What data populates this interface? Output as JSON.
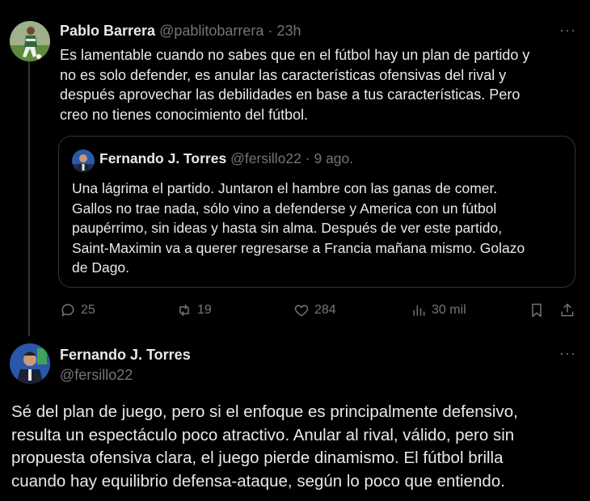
{
  "tweet": {
    "author_name": "Pablo Barrera",
    "author_handle": "@pablitobarrera",
    "separator": "·",
    "time": "23h",
    "more": "···",
    "text": "Es lamentable cuando no sabes que en el fútbol hay un plan  de partido y\nno es solo defender, es anular las características ofensivas del rival y\ndespués aprovechar las debilidades  en base a tus características. Pero\ncreo no tienes conocimiento del fútbol.",
    "quoted": {
      "author_name": "Fernando J. Torres",
      "author_handle": "@fersillo22",
      "separator": "·",
      "time": "9 ago.",
      "text": "Una lágrima el partido. Juntaron el hambre con las ganas de comer.\nGallos no trae nada, sólo vino a defenderse y America con un fútbol\npaupérrimo, sin ideas y hasta sin alma. Después de ver este partido,\nSaint-Maximin va a querer regresarse a Francia mañana mismo. Golazo\nde Dago."
    },
    "actions": {
      "replies": "25",
      "reposts": "19",
      "likes": "284",
      "views": "30 mil"
    },
    "icons": [
      "reply-icon",
      "repost-icon",
      "like-icon",
      "views-icon",
      "bookmark-icon",
      "share-icon"
    ]
  },
  "reply": {
    "author_name": "Fernando J. Torres",
    "author_handle": "@fersillo22",
    "more": "···",
    "text": "Sé del plan de juego, pero si el enfoque es principalmente defensivo,\nresulta un espectáculo poco atractivo. Anular al rival, válido, pero sin\npropuesta ofensiva clara, el juego pierde dinamismo. El fútbol brilla\ncuando hay equilibrio defensa-ataque, según lo poco que entiendo."
  },
  "colors": {
    "background": "#000000",
    "text": "#e7e9ea",
    "muted": "#71767b",
    "border": "#2f3336"
  }
}
